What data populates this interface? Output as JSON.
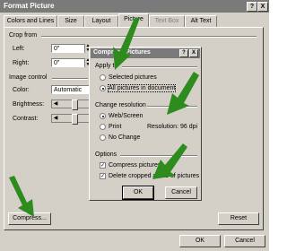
{
  "window": {
    "title": "Format Picture",
    "help_glyph": "?",
    "close_glyph": "X"
  },
  "tabs": [
    {
      "label": "Colors and Lines"
    },
    {
      "label": "Size"
    },
    {
      "label": "Layout"
    },
    {
      "label": "Picture"
    },
    {
      "label": "Text Box"
    },
    {
      "label": "Alt Text"
    }
  ],
  "crop": {
    "heading": "Crop from",
    "left_label": "Left:",
    "left_value": "0\"",
    "right_label": "Right:",
    "right_value": "0\""
  },
  "image_control": {
    "heading": "Image control",
    "color_label": "Color:",
    "color_value": "Automatic",
    "brightness_label": "Brightness:",
    "contrast_label": "Contrast:",
    "brightness_level": 0.5,
    "contrast_level": 0.5
  },
  "buttons": {
    "compress": "Compress...",
    "reset": "Reset",
    "ok": "OK",
    "cancel": "Cancel"
  },
  "compress_dialog": {
    "title": "Compress Pictures",
    "help_glyph": "?",
    "close_glyph": "X",
    "apply_heading": "Apply to",
    "apply_selected": "Selected pictures",
    "apply_all": "All pictures in document",
    "resolution_heading": "Change resolution",
    "res_web": "Web/Screen",
    "res_print": "Print",
    "res_nochange": "No Change",
    "resolution_readout": "Resolution:   96 dpi",
    "options_heading": "Options",
    "opt_compress": "Compress pictures",
    "opt_delete": "Delete cropped areas of pictures",
    "ok": "OK",
    "cancel": "Cancel"
  },
  "arrow_color": "#2e8b1e"
}
